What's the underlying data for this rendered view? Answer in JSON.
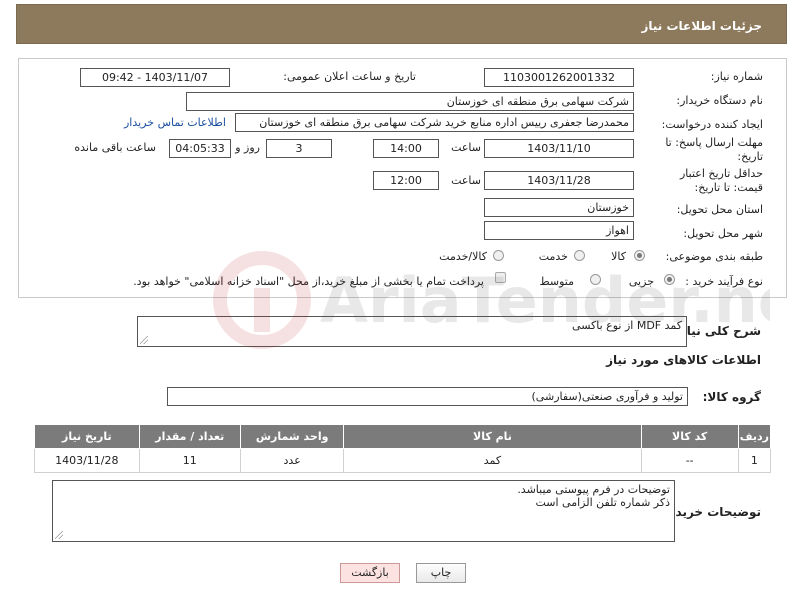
{
  "header": {
    "title": "جزئیات اطلاعات نیاز"
  },
  "form": {
    "need_number_label": "شماره نیاز:",
    "need_number": "1103001262001332",
    "announce_label": "تاریخ و ساعت اعلان عمومی:",
    "announce_value": "1403/11/07 - 09:42",
    "buyer_label": "نام دستگاه خریدار:",
    "buyer_value": "شرکت سهامی برق منطقه ای خوزستان",
    "creator_label": "ایجاد کننده درخواست:",
    "creator_value": "محمدرضا جعفری رییس اداره منابع خرید شرکت سهامی برق منطقه ای خوزستان",
    "contact_link": "اطلاعات تماس خریدار",
    "deadline_label": "مهلت ارسال پاسخ: تا تاریخ:",
    "deadline_date": "1403/11/10",
    "time_label": "ساعت",
    "deadline_time": "14:00",
    "days_value": "3",
    "days_label": "روز و",
    "remaining_value": "04:05:33",
    "remaining_label": "ساعت باقی مانده",
    "price_label": "حداقل تاریخ اعتبار قیمت: تا تاریخ:",
    "price_date": "1403/11/28",
    "price_time": "12:00",
    "province_label": "استان محل تحویل:",
    "province_value": "خوزستان",
    "city_label": "شهر محل تحویل:",
    "city_value": "اهواز",
    "category_label": "طبقه بندی موضوعی:",
    "category_options": [
      "کالا",
      "خدمت",
      "کالا/خدمت"
    ],
    "process_label": "نوع فرآیند خرید :",
    "process_options": [
      "جزیی",
      "متوسط"
    ],
    "payment_note": "پرداخت تمام یا بخشی از مبلغ خرید،از محل \"اسناد خزانه اسلامی\" خواهد بود."
  },
  "description": {
    "label": "شرح کلی نیاز:",
    "value": "کمد MDF از نوع باکسی"
  },
  "goods": {
    "section_title": "اطلاعات کالاهای مورد نیاز",
    "group_label": "گروه کالا:",
    "group_value": "تولید و فرآوری صنعتی(سفارشی)",
    "columns": [
      "ردیف",
      "کد کالا",
      "نام کالا",
      "واحد شمارش",
      "تعداد / مقدار",
      "تاریخ نیاز"
    ],
    "rows": [
      [
        "1",
        "--",
        "کمد",
        "عدد",
        "11",
        "1403/11/28"
      ]
    ]
  },
  "buyer_notes": {
    "label": "توضیحات خریدار:",
    "line1": "توضیحات در فرم پیوستی میباشد.",
    "line2": "ذکر شماره تلفن الزامی است"
  },
  "buttons": {
    "print": "چاپ",
    "back": "بازگشت"
  },
  "watermark": "AriaTender.net"
}
